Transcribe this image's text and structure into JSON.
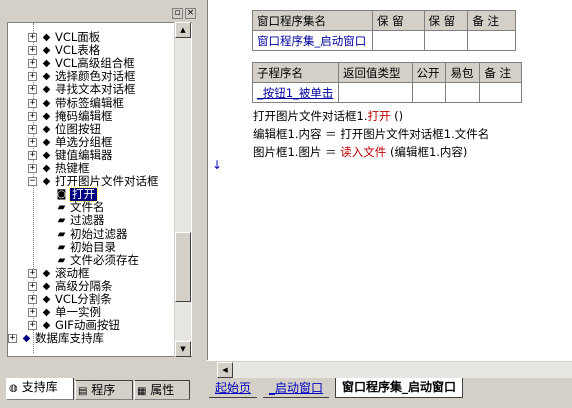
{
  "tree": {
    "items": [
      {
        "label": "VCL面板",
        "indent": 0,
        "expander": "+"
      },
      {
        "label": "VCL表格",
        "indent": 0,
        "expander": "+"
      },
      {
        "label": "VCL高级组合框",
        "indent": 0,
        "expander": "+"
      },
      {
        "label": "选择颜色对话框",
        "indent": 0,
        "expander": "+"
      },
      {
        "label": "寻找文本对话框",
        "indent": 0,
        "expander": "+"
      },
      {
        "label": "带标签编辑框",
        "indent": 0,
        "expander": "+"
      },
      {
        "label": "掩码编辑框",
        "indent": 0,
        "expander": "+"
      },
      {
        "label": "位图按钮",
        "indent": 0,
        "expander": "+"
      },
      {
        "label": "单选分组框",
        "indent": 0,
        "expander": "+"
      },
      {
        "label": "键值编辑器",
        "indent": 0,
        "expander": "+"
      },
      {
        "label": "热键框",
        "indent": 0,
        "expander": "+"
      },
      {
        "label": "打开图片文件对话框",
        "indent": 0,
        "expander": "-"
      },
      {
        "label": "打开",
        "indent": 1,
        "expander": "",
        "selected": true
      },
      {
        "label": "文件名",
        "indent": 1,
        "expander": ""
      },
      {
        "label": "过滤器",
        "indent": 1,
        "expander": ""
      },
      {
        "label": "初始过滤器",
        "indent": 1,
        "expander": ""
      },
      {
        "label": "初始目录",
        "indent": 1,
        "expander": ""
      },
      {
        "label": "文件必须存在",
        "indent": 1,
        "expander": ""
      },
      {
        "label": "滚动框",
        "indent": 0,
        "expander": "+"
      },
      {
        "label": "高级分隔条",
        "indent": 0,
        "expander": "+"
      },
      {
        "label": "VCL分割条",
        "indent": 0,
        "expander": "+"
      },
      {
        "label": "单一实例",
        "indent": 0,
        "expander": "+"
      },
      {
        "label": "GIF动画按钮",
        "indent": 0,
        "expander": "+"
      },
      {
        "label": "数据库支持库",
        "indent": -1,
        "expander": "+"
      }
    ]
  },
  "left_tabs": [
    "支持库",
    "程序",
    "属性"
  ],
  "window_table": {
    "headers": [
      "窗口程序集名",
      "保 留",
      "保 留",
      "备 注"
    ],
    "row": [
      "窗口程序集_启动窗口",
      "",
      "",
      ""
    ]
  },
  "sub_table": {
    "headers": [
      "子程序名",
      "返回值类型",
      "公开",
      "易包",
      "备 注"
    ],
    "row": [
      "_按钮1_被单击",
      "",
      "",
      "",
      ""
    ]
  },
  "code": {
    "line1_a": "打开图片文件对话框1.",
    "line1_kw": "打开",
    "line1_b": " ()",
    "line2": "编辑框1.内容 ＝ 打开图片文件对话框1.文件名",
    "line3_a": "图片框1.图片 ＝ ",
    "line3_kw": "读入文件",
    "line3_b": " (编辑框1.内容)"
  },
  "editor_tabs": [
    "起始页",
    "_启动窗口",
    "窗口程序集_启动窗口"
  ],
  "icons": {
    "expand": "plus-box-icon",
    "collapse": "minus-box-icon",
    "component": "component-icon",
    "method": "method-icon",
    "property": "property-icon",
    "arrow": "blue-down-arrow-icon"
  }
}
